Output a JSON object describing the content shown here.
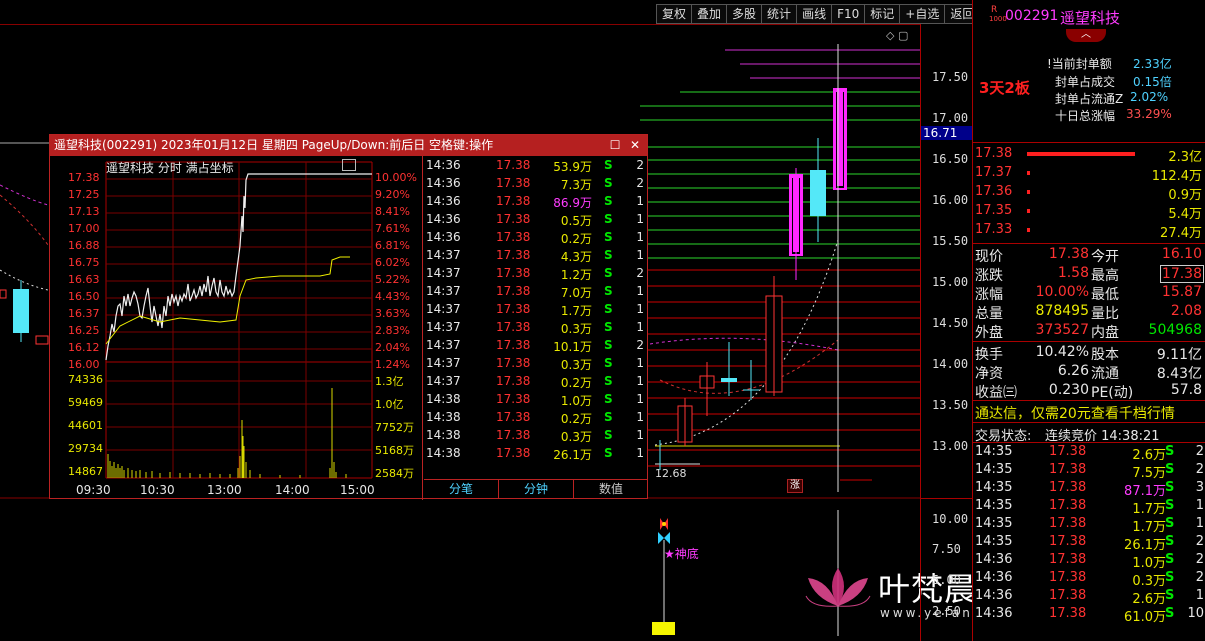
{
  "toolbar": [
    "复权",
    "叠加",
    "多股",
    "统计",
    "画线",
    "F10",
    "标记",
    "+自选",
    "返回"
  ],
  "main_chart": {
    "price_labels": [
      "17.50",
      "17.00",
      "16.50",
      "16.00",
      "15.50",
      "15.00",
      "14.50",
      "14.00",
      "13.50",
      "13.00"
    ],
    "current_price_tag": "16.71",
    "low_label": "12.68",
    "zhang_badge": "涨",
    "indicator_labels": [
      "10.00",
      "7.50",
      "5.00",
      "2.50"
    ],
    "shendi_label": "★神底",
    "watermark_text": "叶梵晨指标公式网",
    "watermark_url": "www.yefanchen.com"
  },
  "popup": {
    "title": "遥望科技(002291) 2023年01月12日 星期四 PageUp/Down:前后日 空格键:操作",
    "mini_header": "遥望科技  分时 满占坐标",
    "price_axis": [
      "17.38",
      "17.25",
      "17.13",
      "17.00",
      "16.88",
      "16.75",
      "16.63",
      "16.50",
      "16.37",
      "16.25",
      "16.12",
      "16.00"
    ],
    "pct_axis": [
      "10.00%",
      "9.20%",
      "8.41%",
      "7.61%",
      "6.81%",
      "6.02%",
      "5.22%",
      "4.43%",
      "3.63%",
      "2.83%",
      "2.04%",
      "1.24%"
    ],
    "vol_axis_left": [
      "74336",
      "59469",
      "44601",
      "29734",
      "14867"
    ],
    "vol_axis_right": [
      "1.3亿",
      "1.0亿",
      "7752万",
      "5168万",
      "2584万"
    ],
    "time_axis": [
      "09:30",
      "10:30",
      "13:00",
      "14:00",
      "15:00"
    ],
    "ticks": [
      {
        "t": "14:36",
        "p": "17.38",
        "v": "53.9万",
        "s": "S",
        "n": "2",
        "big": false
      },
      {
        "t": "14:36",
        "p": "17.38",
        "v": "7.3万",
        "s": "S",
        "n": "2",
        "big": false
      },
      {
        "t": "14:36",
        "p": "17.38",
        "v": "86.9万",
        "s": "S",
        "n": "1",
        "big": true
      },
      {
        "t": "14:36",
        "p": "17.38",
        "v": "0.5万",
        "s": "S",
        "n": "1",
        "big": false
      },
      {
        "t": "14:36",
        "p": "17.38",
        "v": "0.2万",
        "s": "S",
        "n": "1",
        "big": false
      },
      {
        "t": "14:37",
        "p": "17.38",
        "v": "4.3万",
        "s": "S",
        "n": "1",
        "big": false
      },
      {
        "t": "14:37",
        "p": "17.38",
        "v": "1.2万",
        "s": "S",
        "n": "2",
        "big": false
      },
      {
        "t": "14:37",
        "p": "17.38",
        "v": "7.0万",
        "s": "S",
        "n": "1",
        "big": false
      },
      {
        "t": "14:37",
        "p": "17.38",
        "v": "1.7万",
        "s": "S",
        "n": "1",
        "big": false
      },
      {
        "t": "14:37",
        "p": "17.38",
        "v": "0.3万",
        "s": "S",
        "n": "1",
        "big": false
      },
      {
        "t": "14:37",
        "p": "17.38",
        "v": "10.1万",
        "s": "S",
        "n": "2",
        "big": false
      },
      {
        "t": "14:37",
        "p": "17.38",
        "v": "0.3万",
        "s": "S",
        "n": "1",
        "big": false
      },
      {
        "t": "14:37",
        "p": "17.38",
        "v": "0.2万",
        "s": "S",
        "n": "1",
        "big": false
      },
      {
        "t": "14:38",
        "p": "17.38",
        "v": "1.0万",
        "s": "S",
        "n": "1",
        "big": false
      },
      {
        "t": "14:38",
        "p": "17.38",
        "v": "0.2万",
        "s": "S",
        "n": "1",
        "big": false
      },
      {
        "t": "14:38",
        "p": "17.38",
        "v": "0.3万",
        "s": "S",
        "n": "1",
        "big": false
      },
      {
        "t": "14:38",
        "p": "17.38",
        "v": "26.1万",
        "s": "S",
        "n": "1",
        "big": false
      }
    ],
    "tabs": [
      "分笔",
      "分钟",
      "数值"
    ]
  },
  "rpanel": {
    "r_badge": "R",
    "code": "002291",
    "name": "遥望科技",
    "tag": "3天2板",
    "seal_amount_label": "!当前封单额",
    "seal_amount": "2.33亿",
    "seal_vs_deal_label": "封单占成交",
    "seal_vs_deal": "0.15倍",
    "seal_vs_float_label": "封单占流通Z",
    "seal_vs_float": "2.02%",
    "ten_day_label": "十日总涨幅",
    "ten_day": "33.29%",
    "bids": [
      {
        "price": "17.38",
        "vol": "2.3亿"
      },
      {
        "price": "17.37",
        "vol": "112.4万"
      },
      {
        "price": "17.36",
        "vol": "0.9万"
      },
      {
        "price": "17.35",
        "vol": "5.4万"
      },
      {
        "price": "17.33",
        "vol": "27.4万"
      }
    ],
    "quote": [
      {
        "l1": "现价",
        "v1": "17.38",
        "l2": "今开",
        "v2": "16.10"
      },
      {
        "l1": "涨跌",
        "v1": "1.58",
        "l2": "最高",
        "v2": "17.38"
      },
      {
        "l1": "涨幅",
        "v1": "10.00%",
        "l2": "最低",
        "v2": "15.87"
      },
      {
        "l1": "总量",
        "v1": "878495",
        "l2": "量比",
        "v2": "2.08"
      },
      {
        "l1": "外盘",
        "v1": "373527",
        "l2": "内盘",
        "v2": "504968"
      }
    ],
    "fin": [
      {
        "l1": "换手",
        "v1": "10.42%",
        "l2": "股本",
        "v2": "9.11亿"
      },
      {
        "l1": "净资",
        "v1": "6.26",
        "l2": "流通",
        "v2": "8.43亿"
      },
      {
        "l1": "收益㈢",
        "v1": "0.230",
        "l2": "PE(动)",
        "v2": "57.8"
      }
    ],
    "promo": "通达信，仅需20元查看千档行情",
    "trade_status_label": "交易状态:",
    "trade_status": "连续竞价 14:38:21",
    "trades": [
      {
        "t": "14:35",
        "p": "17.38",
        "v": "2.6万",
        "s": "S",
        "n": "2",
        "big": false
      },
      {
        "t": "14:35",
        "p": "17.38",
        "v": "7.5万",
        "s": "S",
        "n": "2",
        "big": false
      },
      {
        "t": "14:35",
        "p": "17.38",
        "v": "87.1万",
        "s": "S",
        "n": "3",
        "big": true
      },
      {
        "t": "14:35",
        "p": "17.38",
        "v": "1.7万",
        "s": "S",
        "n": "1",
        "big": false
      },
      {
        "t": "14:35",
        "p": "17.38",
        "v": "1.7万",
        "s": "S",
        "n": "1",
        "big": false
      },
      {
        "t": "14:35",
        "p": "17.38",
        "v": "26.1万",
        "s": "S",
        "n": "2",
        "big": false
      },
      {
        "t": "14:36",
        "p": "17.38",
        "v": "1.0万",
        "s": "S",
        "n": "2",
        "big": false
      },
      {
        "t": "14:36",
        "p": "17.38",
        "v": "0.3万",
        "s": "S",
        "n": "2",
        "big": false
      },
      {
        "t": "14:36",
        "p": "17.38",
        "v": "2.6万",
        "s": "S",
        "n": "1",
        "big": false
      },
      {
        "t": "14:36",
        "p": "17.38",
        "v": "61.0万",
        "s": "S",
        "n": "10",
        "big": false
      }
    ]
  }
}
